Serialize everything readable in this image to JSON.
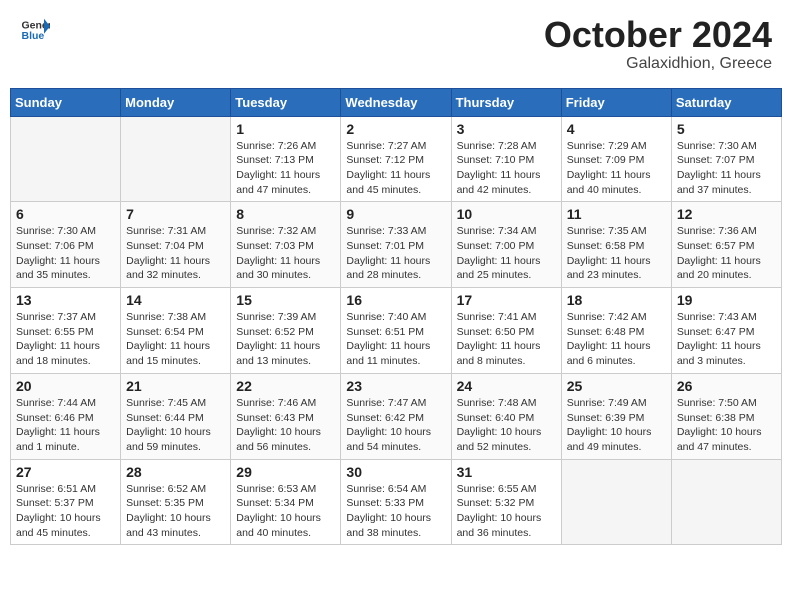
{
  "header": {
    "logo_general": "General",
    "logo_blue": "Blue",
    "month": "October 2024",
    "location": "Galaxidhion, Greece"
  },
  "weekdays": [
    "Sunday",
    "Monday",
    "Tuesday",
    "Wednesday",
    "Thursday",
    "Friday",
    "Saturday"
  ],
  "weeks": [
    [
      {
        "day": "",
        "info": ""
      },
      {
        "day": "",
        "info": ""
      },
      {
        "day": "1",
        "info": "Sunrise: 7:26 AM\nSunset: 7:13 PM\nDaylight: 11 hours and 47 minutes."
      },
      {
        "day": "2",
        "info": "Sunrise: 7:27 AM\nSunset: 7:12 PM\nDaylight: 11 hours and 45 minutes."
      },
      {
        "day": "3",
        "info": "Sunrise: 7:28 AM\nSunset: 7:10 PM\nDaylight: 11 hours and 42 minutes."
      },
      {
        "day": "4",
        "info": "Sunrise: 7:29 AM\nSunset: 7:09 PM\nDaylight: 11 hours and 40 minutes."
      },
      {
        "day": "5",
        "info": "Sunrise: 7:30 AM\nSunset: 7:07 PM\nDaylight: 11 hours and 37 minutes."
      }
    ],
    [
      {
        "day": "6",
        "info": "Sunrise: 7:30 AM\nSunset: 7:06 PM\nDaylight: 11 hours and 35 minutes."
      },
      {
        "day": "7",
        "info": "Sunrise: 7:31 AM\nSunset: 7:04 PM\nDaylight: 11 hours and 32 minutes."
      },
      {
        "day": "8",
        "info": "Sunrise: 7:32 AM\nSunset: 7:03 PM\nDaylight: 11 hours and 30 minutes."
      },
      {
        "day": "9",
        "info": "Sunrise: 7:33 AM\nSunset: 7:01 PM\nDaylight: 11 hours and 28 minutes."
      },
      {
        "day": "10",
        "info": "Sunrise: 7:34 AM\nSunset: 7:00 PM\nDaylight: 11 hours and 25 minutes."
      },
      {
        "day": "11",
        "info": "Sunrise: 7:35 AM\nSunset: 6:58 PM\nDaylight: 11 hours and 23 minutes."
      },
      {
        "day": "12",
        "info": "Sunrise: 7:36 AM\nSunset: 6:57 PM\nDaylight: 11 hours and 20 minutes."
      }
    ],
    [
      {
        "day": "13",
        "info": "Sunrise: 7:37 AM\nSunset: 6:55 PM\nDaylight: 11 hours and 18 minutes."
      },
      {
        "day": "14",
        "info": "Sunrise: 7:38 AM\nSunset: 6:54 PM\nDaylight: 11 hours and 15 minutes."
      },
      {
        "day": "15",
        "info": "Sunrise: 7:39 AM\nSunset: 6:52 PM\nDaylight: 11 hours and 13 minutes."
      },
      {
        "day": "16",
        "info": "Sunrise: 7:40 AM\nSunset: 6:51 PM\nDaylight: 11 hours and 11 minutes."
      },
      {
        "day": "17",
        "info": "Sunrise: 7:41 AM\nSunset: 6:50 PM\nDaylight: 11 hours and 8 minutes."
      },
      {
        "day": "18",
        "info": "Sunrise: 7:42 AM\nSunset: 6:48 PM\nDaylight: 11 hours and 6 minutes."
      },
      {
        "day": "19",
        "info": "Sunrise: 7:43 AM\nSunset: 6:47 PM\nDaylight: 11 hours and 3 minutes."
      }
    ],
    [
      {
        "day": "20",
        "info": "Sunrise: 7:44 AM\nSunset: 6:46 PM\nDaylight: 11 hours and 1 minute."
      },
      {
        "day": "21",
        "info": "Sunrise: 7:45 AM\nSunset: 6:44 PM\nDaylight: 10 hours and 59 minutes."
      },
      {
        "day": "22",
        "info": "Sunrise: 7:46 AM\nSunset: 6:43 PM\nDaylight: 10 hours and 56 minutes."
      },
      {
        "day": "23",
        "info": "Sunrise: 7:47 AM\nSunset: 6:42 PM\nDaylight: 10 hours and 54 minutes."
      },
      {
        "day": "24",
        "info": "Sunrise: 7:48 AM\nSunset: 6:40 PM\nDaylight: 10 hours and 52 minutes."
      },
      {
        "day": "25",
        "info": "Sunrise: 7:49 AM\nSunset: 6:39 PM\nDaylight: 10 hours and 49 minutes."
      },
      {
        "day": "26",
        "info": "Sunrise: 7:50 AM\nSunset: 6:38 PM\nDaylight: 10 hours and 47 minutes."
      }
    ],
    [
      {
        "day": "27",
        "info": "Sunrise: 6:51 AM\nSunset: 5:37 PM\nDaylight: 10 hours and 45 minutes."
      },
      {
        "day": "28",
        "info": "Sunrise: 6:52 AM\nSunset: 5:35 PM\nDaylight: 10 hours and 43 minutes."
      },
      {
        "day": "29",
        "info": "Sunrise: 6:53 AM\nSunset: 5:34 PM\nDaylight: 10 hours and 40 minutes."
      },
      {
        "day": "30",
        "info": "Sunrise: 6:54 AM\nSunset: 5:33 PM\nDaylight: 10 hours and 38 minutes."
      },
      {
        "day": "31",
        "info": "Sunrise: 6:55 AM\nSunset: 5:32 PM\nDaylight: 10 hours and 36 minutes."
      },
      {
        "day": "",
        "info": ""
      },
      {
        "day": "",
        "info": ""
      }
    ]
  ]
}
